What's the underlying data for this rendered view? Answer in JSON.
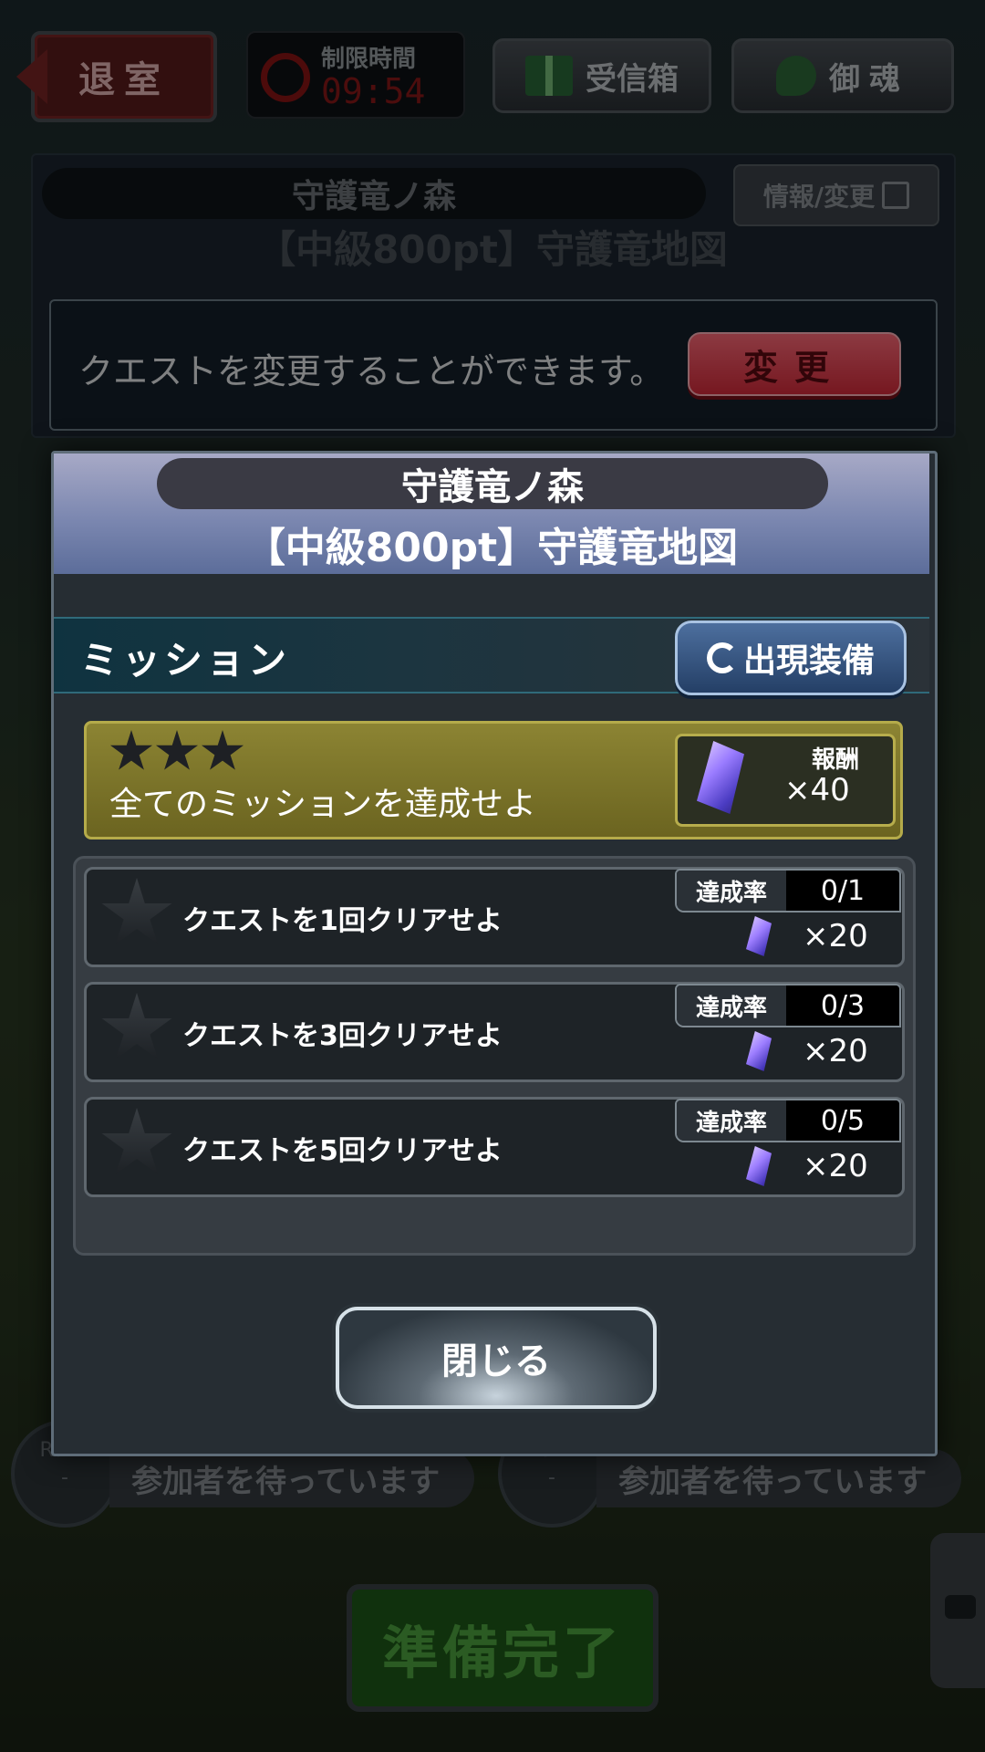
{
  "header": {
    "exit_label": "退室",
    "timer_label": "制限時間",
    "timer_value": "09:54",
    "inbox_label": "受信箱",
    "soul_label": "御魂"
  },
  "background": {
    "quest_name": "守護竜ノ森",
    "quest_sub": "【中級800pt】守護竜地図",
    "info_button": "情報/変更",
    "change_message": "クエストを変更することができます。",
    "change_button": "変更",
    "slots": [
      {
        "rank": "Rank",
        "rank_value": "-",
        "status": "参加者を待っています"
      },
      {
        "rank": "Rank",
        "rank_value": "-",
        "status": "参加者を待っています"
      }
    ],
    "ready_button": "準備完了"
  },
  "modal": {
    "title": "守護竜ノ森",
    "subtitle": "【中級800pt】守護竜地図",
    "section_label": "ミッション",
    "equip_button": "出現装備",
    "all_mission": {
      "text": "全てのミッションを達成せよ",
      "reward_label": "報酬",
      "reward_qty": "×40"
    },
    "missions": [
      {
        "text": "クエストを1回クリアせよ",
        "rate_label": "達成率",
        "rate": "0/1",
        "reward": "×20"
      },
      {
        "text": "クエストを3回クリアせよ",
        "rate_label": "達成率",
        "rate": "0/3",
        "reward": "×20"
      },
      {
        "text": "クエストを5回クリアせよ",
        "rate_label": "達成率",
        "rate": "0/5",
        "reward": "×20"
      }
    ],
    "close_button": "閉じる"
  },
  "colors": {
    "accent_red": "#d72b3b",
    "modal_header": "#7b87b0",
    "gold": "#b5ab4a",
    "crystal": "#9a7cff"
  }
}
